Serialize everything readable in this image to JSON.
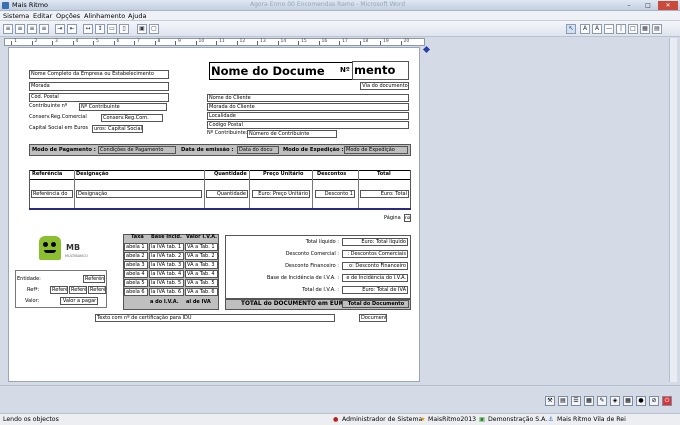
{
  "window": {
    "title": "Mais Ritmo",
    "ghost_title": "Agora Ermo 00 Encomendas Ramo - Microsoft Word",
    "minimize": "–",
    "maximize": "□",
    "close": "✕"
  },
  "menu": {
    "items": [
      "Sistema",
      "Editar",
      "Opções",
      "Alinhamento",
      "Ajuda"
    ]
  },
  "ruler": {
    "numbers": [
      "1",
      "2",
      "3",
      "4",
      "5",
      "6",
      "7",
      "8",
      "9",
      "10",
      "11",
      "12",
      "13",
      "14",
      "15",
      "16",
      "17",
      "18",
      "19",
      "20"
    ]
  },
  "doc": {
    "title": "Nome do Documento",
    "title_split": "Nome do Docume",
    "title_num": "Nº",
    "title_end": "mento",
    "via": "Via do documento",
    "company": "Nome Completo da Empresa ou Estabelecimento",
    "address": "Morada",
    "postal": "Cód. Postal",
    "contrib_label": "Contribuinte nº",
    "contrib_value": "Nº Contribuinte",
    "conserv_label": "Conserv.Reg.Comercial",
    "conserv_value": "Conserv.Reg.Com.",
    "capital_label": "Capital Social em Euros",
    "capital_value": "uros: Capital Social",
    "client_name": "Nome do Cliente",
    "client_address": "Morada do Cliente",
    "client_city": "Localidade",
    "client_postal": "Código Postal",
    "client_contrib_label": "Nº Contribuinte:",
    "client_contrib_value": "Número de Contribuinte",
    "pay_label": "Modo de Pagamento :",
    "pay_value": "Condições de Pagamento",
    "date_label": "Data de emissão :",
    "date_value": "Data do docu",
    "ship_label": "Modo de Expedição :",
    "ship_value": "Modo de Expedição",
    "cols": [
      "Referência",
      "Designação",
      "Quantidade",
      "Preço Unitário",
      "Descontos",
      "Total"
    ],
    "row": [
      "Referência do",
      "Designação",
      "Quantidade",
      "Euro: Preço Unitário",
      "Desconto 1",
      "Euro: Total"
    ],
    "page_label": "Página",
    "page_value": "na",
    "mb_logo": "MB",
    "mb_sub": "MULTIBANCO",
    "entity_label": "Entidade:",
    "entity_value": "Referên",
    "ref_label": "Refª:",
    "ref_values": [
      "Referê",
      "Referê",
      "Referê"
    ],
    "value_label": "Valor:",
    "value_value": "Valor a pagar",
    "vat_cols": [
      "Taxa",
      "Base Incid.",
      "Valor I.V.A."
    ],
    "vat_rows": [
      [
        "abela 1",
        "la IVA tab. 1",
        "VA a Tab. 1"
      ],
      [
        "abela 2",
        "la IVA tab. 2",
        "VA a Tab. 2"
      ],
      [
        "abela 3",
        "la IVA tab. 3",
        "VA a Tab. 3"
      ],
      [
        "abela 4",
        "la IVA tab. 4",
        "VA a Tab. 4"
      ],
      [
        "abela 5",
        "la IVA tab. 5",
        "VA a Tab. 5"
      ],
      [
        "abela 6",
        "la IVA tab. 6",
        "VA a Tab. 6"
      ]
    ],
    "vat_total_a": "a do I.V.A.",
    "vat_total_b": "al de IVA",
    "totals": [
      [
        "Total líquido :",
        "Euro: Total líquido"
      ],
      [
        "Desconto Comercial :",
        ": Descontos Comerciais"
      ],
      [
        "Desconto Financeiro :",
        "o: Desconto Financeiro"
      ],
      [
        "Base de Incidência de I.V.A. :",
        "e de Incidência do I.V.A."
      ],
      [
        "Total de I.V.A. :",
        "Euro: Total de IVA"
      ]
    ],
    "grand_label": "TOTAL do DOCUMENTO em EUR",
    "grand_value": "Total do Documento",
    "cert_text": "Texto com nº de certificação para IDU",
    "doc_code": "Document"
  },
  "status": {
    "left": "Lendo os objectos",
    "user": "Administrador de Sistema",
    "app": "MaisRitmo2013",
    "company": "Demonstração S.A.",
    "site": "Mais Ritmo Vila de Rei"
  },
  "colors": {
    "band": "#bfbfbf",
    "accent": "#3b6db3",
    "page": "#ffffff"
  }
}
